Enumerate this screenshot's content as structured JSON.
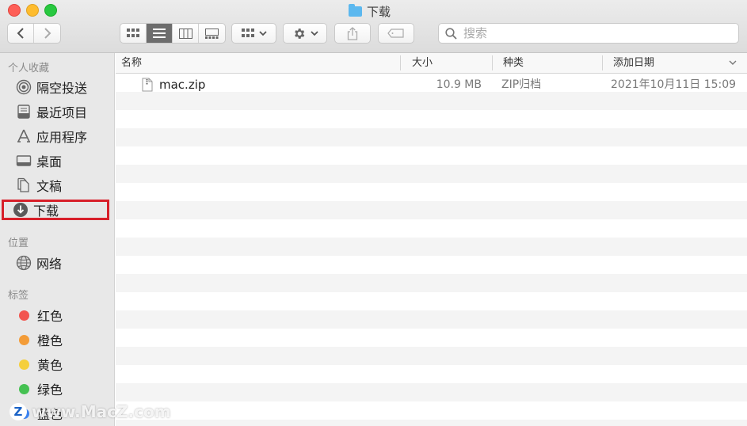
{
  "window": {
    "title": "下载"
  },
  "toolbar": {
    "search_placeholder": "搜索"
  },
  "sidebar": {
    "favorites_header": "个人收藏",
    "favorites": [
      "隔空投送",
      "最近项目",
      "应用程序",
      "桌面",
      "文稿",
      "下载"
    ],
    "locations_header": "位置",
    "locations": [
      "网络"
    ],
    "tags_header": "标签",
    "tags": [
      {
        "label": "红色",
        "color": "#f2554f"
      },
      {
        "label": "橙色",
        "color": "#f39c38"
      },
      {
        "label": "黄色",
        "color": "#f5cf3c"
      },
      {
        "label": "绿色",
        "color": "#45c152"
      },
      {
        "label": "蓝色",
        "color": "#3b82f0"
      }
    ]
  },
  "columns": {
    "name": "名称",
    "size": "大小",
    "kind": "种类",
    "date_added": "添加日期"
  },
  "files": [
    {
      "name": "mac.zip",
      "size": "10.9 MB",
      "kind": "ZIP归档",
      "date_added": "2021年10月11日 15:09"
    }
  ],
  "watermark": {
    "text": "www.MacZ.com",
    "logo": "Z"
  }
}
